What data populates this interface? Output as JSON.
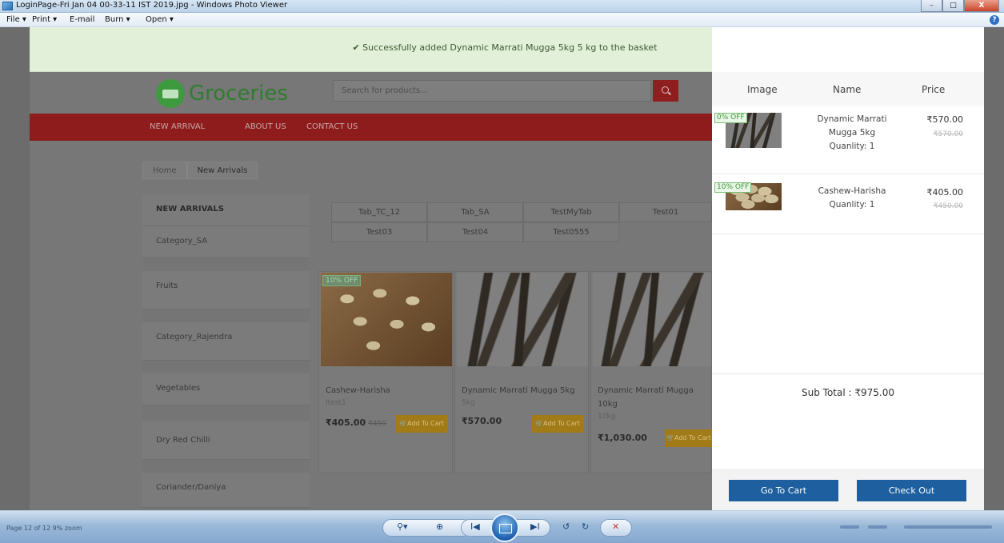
{
  "window": {
    "title": "LoginPage-Fri Jan 04 00-33-11 IST 2019.jpg - Windows Photo Viewer",
    "controls": {
      "minimize": "–",
      "maximize": "□",
      "close": "X"
    }
  },
  "menu": {
    "items": [
      "File ▾",
      "Print ▾",
      "E-mail",
      "Burn ▾",
      "Open ▾"
    ],
    "help": "?"
  },
  "alert": {
    "message": "✔ Successfully added Dynamic Marrati Mugga 5kg 5 kg to the basket",
    "close": "×"
  },
  "site": {
    "logo": "Groceries",
    "search": {
      "placeholder": "Search for products..."
    },
    "nav": [
      "NEW ARRIVAL",
      "ABOUT US",
      "CONTACT US"
    ],
    "breadcrumb": [
      "Home",
      "New Arrivals"
    ],
    "categories": [
      "NEW ARRIVALS",
      "Category_SA",
      "Fruits",
      "Category_Rajendra",
      "Vegetables",
      "Dry Red Chilli",
      "Coriander/Daniya"
    ],
    "tabs": [
      "Tab_TC_12",
      "Tab_SA",
      "TestMyTab",
      "Test01",
      "Test03",
      "Test04",
      "Test0555"
    ],
    "products": [
      {
        "badge": "10% OFF",
        "name": "Cashew-Harisha",
        "sub": "Itest1",
        "price": "₹405.00",
        "old_price": "₹450",
        "button": "🛒Add To Cart"
      },
      {
        "badge": "",
        "name": "Dynamic Marrati Mugga 5kg",
        "sub": "5kg",
        "price": "₹570.00",
        "old_price": "",
        "button": "🛒Add To Cart"
      },
      {
        "badge": "",
        "name": "Dynamic Marrati Mugga 10kg",
        "sub": "10kg",
        "price": "₹1,030.00",
        "old_price": "",
        "button": "🛒Add To Cart"
      }
    ]
  },
  "basket": {
    "headers": {
      "image": "Image",
      "name": "Name",
      "price": "Price"
    },
    "items": [
      {
        "badge": "0% OFF",
        "name_line1": "Dynamic Marrati",
        "name_line2": "Mugga 5kg",
        "quantity": "Quanlity: 1",
        "price": "₹570.00",
        "old_price": "₹570.00"
      },
      {
        "badge": "10% OFF",
        "name_line1": "Cashew-Harisha",
        "quantity": "Quanlity: 1",
        "price": "₹405.00",
        "old_price": "₹450.00"
      }
    ],
    "subtotal": "Sub Total : ₹975.00",
    "go_to_cart": "Go To Cart",
    "check_out": "Check Out"
  },
  "toolbar": {
    "left_text": "Page 12 of 12    9% zoom",
    "buttons": {
      "zoom": "⚲▾",
      "fit": "⊕",
      "prev": "I◀",
      "next": "▶I",
      "rotate_ccw": "↺",
      "rotate_cw": "↻",
      "delete": "✕"
    }
  }
}
